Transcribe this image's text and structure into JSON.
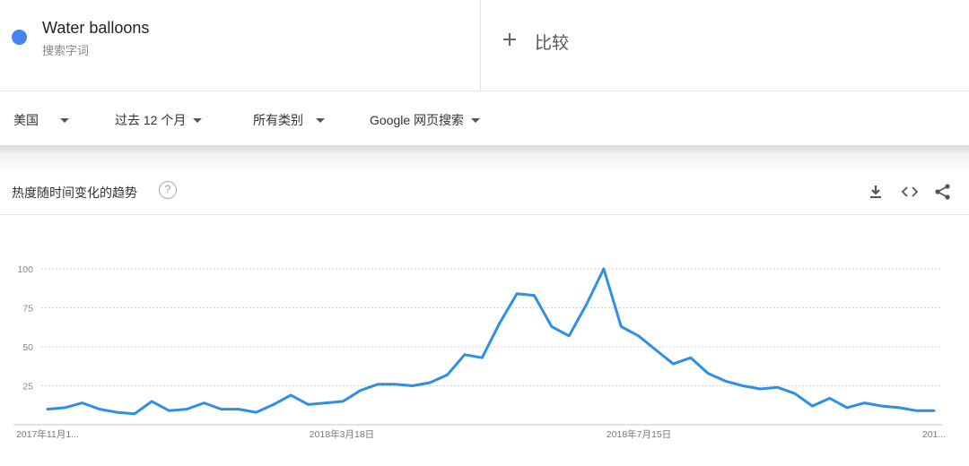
{
  "term": {
    "name": "Water balloons",
    "type": "搜索字词",
    "color": "#4285f4"
  },
  "compare": {
    "icon": "plus-icon",
    "label": "比较"
  },
  "filters": {
    "region": "美国",
    "period": "过去 12 个月",
    "category": "所有类别",
    "source": "Google 网页搜索"
  },
  "card": {
    "title": "热度随时间变化的趋势",
    "help_icon": "?",
    "actions": [
      "download-icon",
      "embed-icon",
      "share-icon"
    ]
  },
  "chart_data": {
    "type": "line",
    "title": "",
    "xlabel": "",
    "ylabel": "",
    "ylim": [
      0,
      100
    ],
    "yticks": [
      25,
      50,
      75,
      100
    ],
    "grid": true,
    "line_color": "#2f8fe6",
    "x_tick_labels": [
      "2017年11月1...",
      "2018年3月18日",
      "2018年7月15日",
      "201..."
    ],
    "series": [
      {
        "values": [
          10,
          11,
          14,
          10,
          8,
          7,
          15,
          9,
          10,
          14,
          10,
          10,
          8,
          13,
          19,
          13,
          14,
          15,
          22,
          26,
          26,
          25,
          27,
          32,
          45,
          43,
          65,
          84,
          83,
          63,
          57,
          77,
          100,
          63,
          57,
          48,
          39,
          43,
          33,
          28,
          25,
          23,
          24,
          20,
          12,
          17,
          11,
          14,
          12,
          11,
          9,
          9
        ]
      }
    ]
  }
}
